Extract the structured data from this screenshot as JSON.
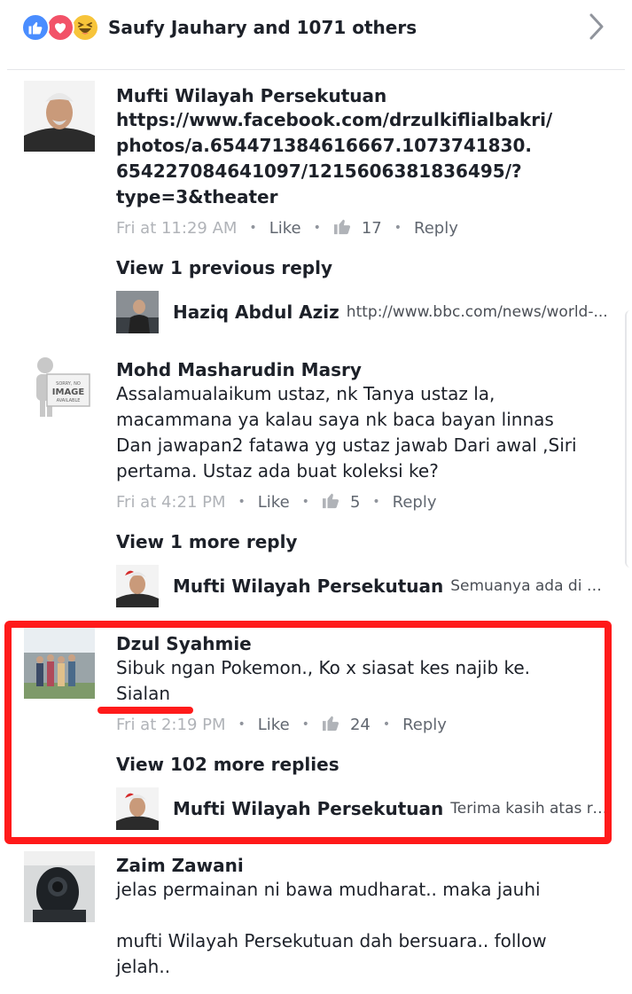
{
  "reactions": {
    "summary": "Saufy Jauhary and 1071 others",
    "icons": [
      "like-icon",
      "love-icon",
      "haha-icon"
    ]
  },
  "comments": [
    {
      "author": "Mufti Wilayah Persekutuan",
      "text": "https://www.facebook.com/drzulkiflialbakri/\nphotos/a.654471384616667.1073741830.\n654227084641097/1215606381836495/?\ntype=3&theater",
      "time": "Fri at 11:29 AM",
      "like_label": "Like",
      "likes": "17",
      "reply_label": "Reply",
      "view_more": "View 1 previous reply",
      "reply": {
        "author": "Haziq Abdul Aziz",
        "snippet": "http://www.bbc.com/news/world-..."
      }
    },
    {
      "author": "Mohd Masharudin Masry",
      "text": "Assalamualaikum ustaz, nk Tanya ustaz la,\nmacammana ya kalau saya nk baca bayan linnas\nDan jawapan2 fatawa yg ustaz jawab Dari awal ,Siri\npertama. Ustaz ada buat koleksi ke?",
      "time": "Fri at 4:21 PM",
      "like_label": "Like",
      "likes": "5",
      "reply_label": "Reply",
      "view_more": "View 1 more reply",
      "reply": {
        "author": "Mufti Wilayah Persekutuan",
        "snippet": "Semuanya ada di ww..."
      },
      "avatar_placeholder": {
        "line1": "SORRY, NO",
        "line2": "IMAGE",
        "line3": "AVAILABLE"
      }
    },
    {
      "author": "Dzul Syahmie",
      "text": "Sibuk ngan Pokemon., Ko x siasat kes najib ke.\nSialan",
      "time": "Fri at 2:19 PM",
      "like_label": "Like",
      "likes": "24",
      "reply_label": "Reply",
      "view_more": "View 102 more replies",
      "reply": {
        "author": "Mufti Wilayah Persekutuan",
        "snippet": "Terima kasih atas res..."
      }
    },
    {
      "author": "Zaim Zawani",
      "text": "jelas permainan ni bawa mudharat.. maka jauhi\n\nmufti Wilayah Persekutuan dah bersuara.. follow\njelah.."
    }
  ],
  "colors": {
    "highlight": "#ff1a1a",
    "like_blue": "#4a8dff",
    "meta_gray": "#b0b3b8"
  }
}
